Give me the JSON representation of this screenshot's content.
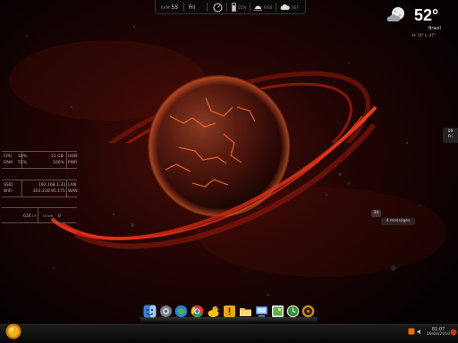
{
  "topbar": {
    "ram_label": "RAM",
    "ram_value": "55",
    "day_value": "Fri",
    "mem_label": "55%",
    "net_label": "RISE",
    "wx_label": "SET"
  },
  "weather": {
    "temperature": "52°",
    "city": "Brasil",
    "high_low": "H: 74°   L: 47°"
  },
  "meters": {
    "cpu_label": "CPU",
    "cpu_value": "16%",
    "hdd_size": "21 GB",
    "hdd_label": "HDD",
    "ram_label": "RAM",
    "ram_value": "55%",
    "pwr_value": "100%",
    "pwr_label": "PWR",
    "ssid_label": "SSID",
    "lan_ip": "192.168.1.33",
    "lan_label": "LAN",
    "wifi_label": "WIFI",
    "wan_ip": "201.230.95.175",
    "wan_label": "WAN",
    "up_value": "624",
    "up_label": "UP",
    "down_label": "DOWN",
    "down_value": "0"
  },
  "notifier": {
    "date_num": "09",
    "date_day": "Fri",
    "count": "34",
    "message": "4 messages"
  },
  "dock": {
    "icons": [
      "finder-icon",
      "gear-icon",
      "globe-icon",
      "chrome-icon",
      "duck-icon",
      "warning-icon",
      "folder-icon",
      "network-icon",
      "image-icon",
      "clock-icon",
      "music-icon"
    ]
  },
  "taskbar": {
    "time": "01:07",
    "date": "09/04/2010"
  },
  "colors": {
    "accent": "#c9301a",
    "background": "#050101"
  }
}
